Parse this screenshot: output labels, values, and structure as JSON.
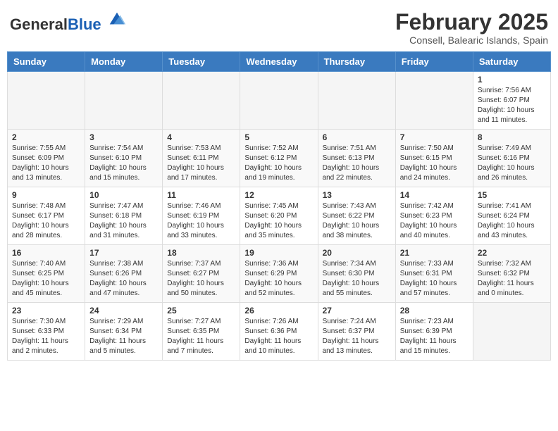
{
  "header": {
    "logo_general": "General",
    "logo_blue": "Blue",
    "month_title": "February 2025",
    "location": "Consell, Balearic Islands, Spain"
  },
  "days_of_week": [
    "Sunday",
    "Monday",
    "Tuesday",
    "Wednesday",
    "Thursday",
    "Friday",
    "Saturday"
  ],
  "weeks": [
    {
      "days": [
        {
          "num": "",
          "info": ""
        },
        {
          "num": "",
          "info": ""
        },
        {
          "num": "",
          "info": ""
        },
        {
          "num": "",
          "info": ""
        },
        {
          "num": "",
          "info": ""
        },
        {
          "num": "",
          "info": ""
        },
        {
          "num": "1",
          "info": "Sunrise: 7:56 AM\nSunset: 6:07 PM\nDaylight: 10 hours\nand 11 minutes."
        }
      ]
    },
    {
      "days": [
        {
          "num": "2",
          "info": "Sunrise: 7:55 AM\nSunset: 6:09 PM\nDaylight: 10 hours\nand 13 minutes."
        },
        {
          "num": "3",
          "info": "Sunrise: 7:54 AM\nSunset: 6:10 PM\nDaylight: 10 hours\nand 15 minutes."
        },
        {
          "num": "4",
          "info": "Sunrise: 7:53 AM\nSunset: 6:11 PM\nDaylight: 10 hours\nand 17 minutes."
        },
        {
          "num": "5",
          "info": "Sunrise: 7:52 AM\nSunset: 6:12 PM\nDaylight: 10 hours\nand 19 minutes."
        },
        {
          "num": "6",
          "info": "Sunrise: 7:51 AM\nSunset: 6:13 PM\nDaylight: 10 hours\nand 22 minutes."
        },
        {
          "num": "7",
          "info": "Sunrise: 7:50 AM\nSunset: 6:15 PM\nDaylight: 10 hours\nand 24 minutes."
        },
        {
          "num": "8",
          "info": "Sunrise: 7:49 AM\nSunset: 6:16 PM\nDaylight: 10 hours\nand 26 minutes."
        }
      ]
    },
    {
      "days": [
        {
          "num": "9",
          "info": "Sunrise: 7:48 AM\nSunset: 6:17 PM\nDaylight: 10 hours\nand 28 minutes."
        },
        {
          "num": "10",
          "info": "Sunrise: 7:47 AM\nSunset: 6:18 PM\nDaylight: 10 hours\nand 31 minutes."
        },
        {
          "num": "11",
          "info": "Sunrise: 7:46 AM\nSunset: 6:19 PM\nDaylight: 10 hours\nand 33 minutes."
        },
        {
          "num": "12",
          "info": "Sunrise: 7:45 AM\nSunset: 6:20 PM\nDaylight: 10 hours\nand 35 minutes."
        },
        {
          "num": "13",
          "info": "Sunrise: 7:43 AM\nSunset: 6:22 PM\nDaylight: 10 hours\nand 38 minutes."
        },
        {
          "num": "14",
          "info": "Sunrise: 7:42 AM\nSunset: 6:23 PM\nDaylight: 10 hours\nand 40 minutes."
        },
        {
          "num": "15",
          "info": "Sunrise: 7:41 AM\nSunset: 6:24 PM\nDaylight: 10 hours\nand 43 minutes."
        }
      ]
    },
    {
      "days": [
        {
          "num": "16",
          "info": "Sunrise: 7:40 AM\nSunset: 6:25 PM\nDaylight: 10 hours\nand 45 minutes."
        },
        {
          "num": "17",
          "info": "Sunrise: 7:38 AM\nSunset: 6:26 PM\nDaylight: 10 hours\nand 47 minutes."
        },
        {
          "num": "18",
          "info": "Sunrise: 7:37 AM\nSunset: 6:27 PM\nDaylight: 10 hours\nand 50 minutes."
        },
        {
          "num": "19",
          "info": "Sunrise: 7:36 AM\nSunset: 6:29 PM\nDaylight: 10 hours\nand 52 minutes."
        },
        {
          "num": "20",
          "info": "Sunrise: 7:34 AM\nSunset: 6:30 PM\nDaylight: 10 hours\nand 55 minutes."
        },
        {
          "num": "21",
          "info": "Sunrise: 7:33 AM\nSunset: 6:31 PM\nDaylight: 10 hours\nand 57 minutes."
        },
        {
          "num": "22",
          "info": "Sunrise: 7:32 AM\nSunset: 6:32 PM\nDaylight: 11 hours\nand 0 minutes."
        }
      ]
    },
    {
      "days": [
        {
          "num": "23",
          "info": "Sunrise: 7:30 AM\nSunset: 6:33 PM\nDaylight: 11 hours\nand 2 minutes."
        },
        {
          "num": "24",
          "info": "Sunrise: 7:29 AM\nSunset: 6:34 PM\nDaylight: 11 hours\nand 5 minutes."
        },
        {
          "num": "25",
          "info": "Sunrise: 7:27 AM\nSunset: 6:35 PM\nDaylight: 11 hours\nand 7 minutes."
        },
        {
          "num": "26",
          "info": "Sunrise: 7:26 AM\nSunset: 6:36 PM\nDaylight: 11 hours\nand 10 minutes."
        },
        {
          "num": "27",
          "info": "Sunrise: 7:24 AM\nSunset: 6:37 PM\nDaylight: 11 hours\nand 13 minutes."
        },
        {
          "num": "28",
          "info": "Sunrise: 7:23 AM\nSunset: 6:39 PM\nDaylight: 11 hours\nand 15 minutes."
        },
        {
          "num": "",
          "info": ""
        }
      ]
    }
  ]
}
